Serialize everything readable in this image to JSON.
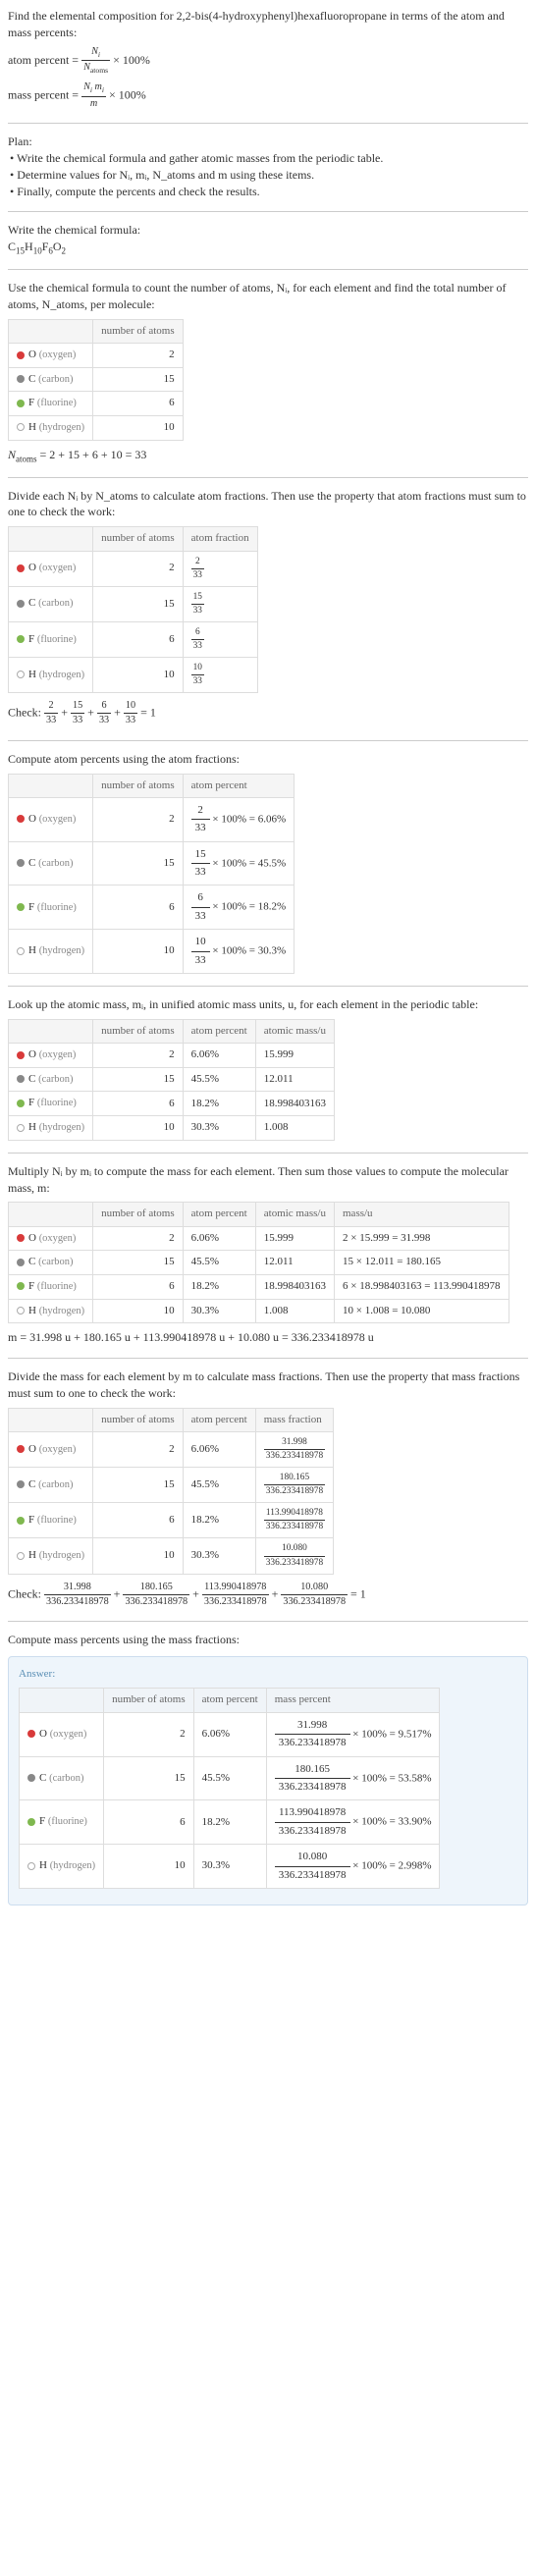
{
  "title": "Find the elemental composition for 2,2-bis(4-hydroxyphenyl)hexafluoropropane in terms of the atom and mass percents:",
  "eq_atom_percent": "atom percent = ",
  "eq_atom_percent_suffix": " × 100%",
  "eq_mass_percent": "mass percent = ",
  "eq_mass_percent_suffix": " × 100%",
  "plan_label": "Plan:",
  "plan_items": [
    "• Write the chemical formula and gather atomic masses from the periodic table.",
    "• Determine values for Nᵢ, mᵢ, N_atoms and m using these items.",
    "• Finally, compute the percents and check the results."
  ],
  "write_formula_label": "Write the chemical formula:",
  "chemical_formula_parts": [
    "C",
    "15",
    "H",
    "10",
    "F",
    "6",
    "O",
    "2"
  ],
  "use_formula_text": "Use the chemical formula to count the number of atoms, Nᵢ, for each element and find the total number of atoms, N_atoms, per molecule:",
  "headers": {
    "element": "",
    "number_of_atoms": "number of atoms",
    "atom_fraction": "atom fraction",
    "atom_percent": "atom percent",
    "atomic_mass": "atomic mass/u",
    "mass": "mass/u",
    "mass_fraction": "mass fraction",
    "mass_percent": "mass percent"
  },
  "elements": [
    {
      "sym": "O",
      "name": "(oxygen)",
      "dot": "dot-o",
      "n": "2"
    },
    {
      "sym": "C",
      "name": "(carbon)",
      "dot": "dot-c",
      "n": "15"
    },
    {
      "sym": "F",
      "name": "(fluorine)",
      "dot": "dot-f",
      "n": "6"
    },
    {
      "sym": "H",
      "name": "(hydrogen)",
      "dot": "dot-h",
      "n": "10"
    }
  ],
  "n_atoms_eq": "N_atoms = 2 + 15 + 6 + 10 = 33",
  "divide_text": "Divide each Nᵢ by N_atoms to calculate atom fractions. Then use the property that atom fractions must sum to one to check the work:",
  "atom_fractions": [
    "2",
    "33",
    "15",
    "33",
    "6",
    "33",
    "10",
    "33"
  ],
  "check1_label": "Check: ",
  "check1_eq": " = 1",
  "compute_atom_percent_label": "Compute atom percents using the atom fractions:",
  "atom_percent_calcs": [
    {
      "num": "2",
      "den": "33",
      "result": " × 100% = 6.06%"
    },
    {
      "num": "15",
      "den": "33",
      "result": " × 100% = 45.5%"
    },
    {
      "num": "6",
      "den": "33",
      "result": " × 100% = 18.2%"
    },
    {
      "num": "10",
      "den": "33",
      "result": " × 100% = 30.3%"
    }
  ],
  "lookup_text": "Look up the atomic mass, mᵢ, in unified atomic mass units, u, for each element in the periodic table:",
  "atom_percents": [
    "6.06%",
    "45.5%",
    "18.2%",
    "30.3%"
  ],
  "atomic_masses": [
    "15.999",
    "12.011",
    "18.998403163",
    "1.008"
  ],
  "multiply_text": "Multiply Nᵢ by mᵢ to compute the mass for each element. Then sum those values to compute the molecular mass, m:",
  "mass_calcs": [
    "2 × 15.999 = 31.998",
    "15 × 12.011 = 180.165",
    "6 × 18.998403163 = 113.990418978",
    "10 × 1.008 = 10.080"
  ],
  "m_eq": "m = 31.998 u + 180.165 u + 113.990418978 u + 10.080 u = 336.233418978 u",
  "divide_mass_text": "Divide the mass for each element by m to calculate mass fractions. Then use the property that mass fractions must sum to one to check the work:",
  "mass_fractions": [
    {
      "num": "31.998",
      "den": "336.233418978"
    },
    {
      "num": "180.165",
      "den": "336.233418978"
    },
    {
      "num": "113.990418978",
      "den": "336.233418978"
    },
    {
      "num": "10.080",
      "den": "336.233418978"
    }
  ],
  "check2_label": "Check: ",
  "check2_eq": " = 1",
  "compute_mass_percent_label": "Compute mass percents using the mass fractions:",
  "answer_label": "Answer:",
  "mass_percent_calcs": [
    {
      "num": "31.998",
      "den": "336.233418978",
      "suffix": " × 100% = 9.517%"
    },
    {
      "num": "180.165",
      "den": "336.233418978",
      "suffix": " × 100% = 53.58%"
    },
    {
      "num": "113.990418978",
      "den": "336.233418978",
      "suffix": " × 100% = 33.90%"
    },
    {
      "num": "10.080",
      "den": "336.233418978",
      "suffix": " × 100% = 2.998%"
    }
  ]
}
